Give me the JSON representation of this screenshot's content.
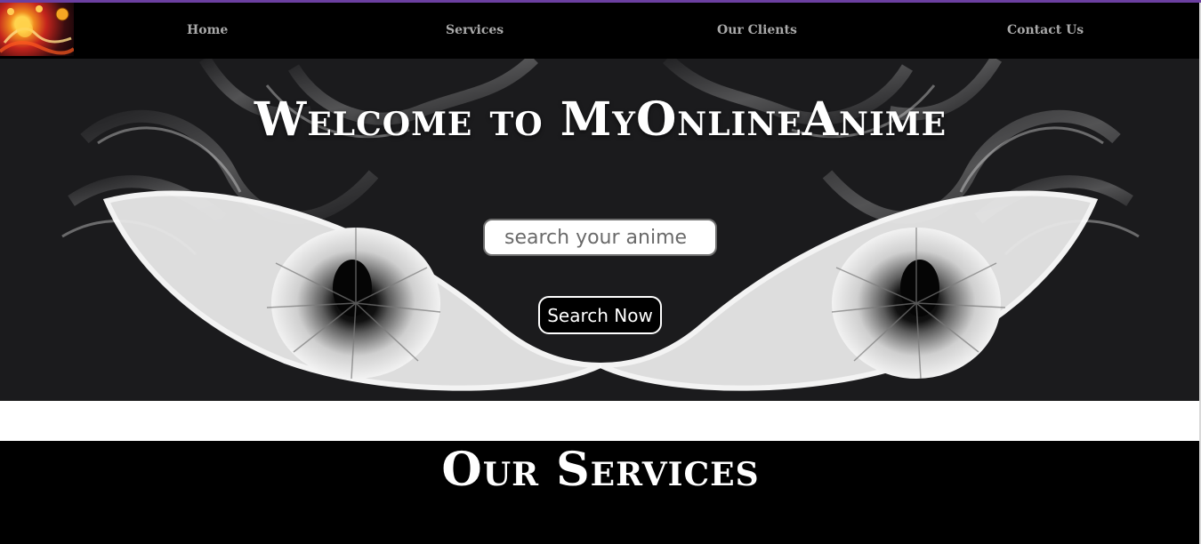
{
  "nav": {
    "items": [
      {
        "label": "Home"
      },
      {
        "label": "Services"
      },
      {
        "label": "Our Clients"
      },
      {
        "label": "Contact Us"
      }
    ]
  },
  "hero": {
    "title": "Welcome to MyOnlineAnime",
    "search": {
      "placeholder": "search your anime",
      "value": ""
    },
    "button_label": "Search Now"
  },
  "services": {
    "title": "Our Services"
  },
  "colors": {
    "accent_line": "#6b3fa0",
    "navbar_bg": "#000000",
    "nav_text": "#a9a9a9",
    "hero_bg": "#1b1b1d",
    "section_bg": "#000000"
  }
}
